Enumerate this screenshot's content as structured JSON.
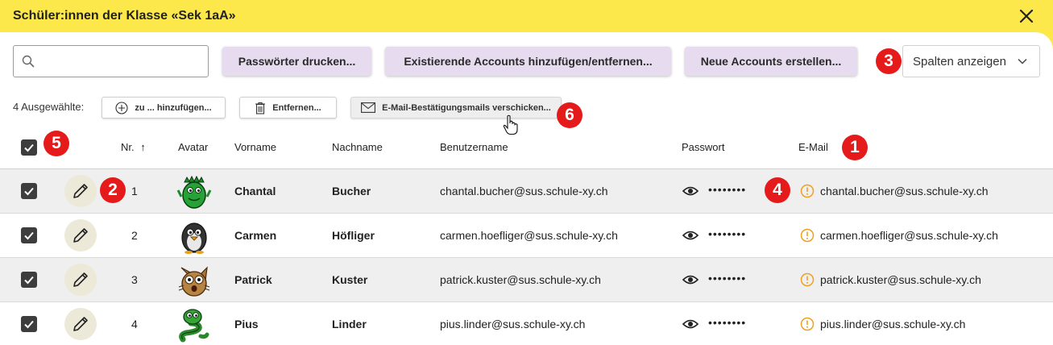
{
  "window": {
    "title": "Schüler:innen der Klasse «Sek 1aA»"
  },
  "toolbar": {
    "search_placeholder": "",
    "print_passwords": "Passwörter drucken...",
    "add_remove_accounts": "Existierende Accounts hinzufügen/entfernen...",
    "new_accounts": "Neue Accounts erstellen...",
    "columns_select": "Spalten anzeigen"
  },
  "selection": {
    "count_label": "4 Ausgewählte:",
    "add_to": "zu ... hinzufügen...",
    "remove": "Entfernen...",
    "send_mails": "E-Mail-Bestätigungsmails verschicken..."
  },
  "table": {
    "columns": [
      "Nr.",
      "Avatar",
      "Vorname",
      "Nachname",
      "Benutzername",
      "Passwort",
      "E-Mail"
    ],
    "sort_indicator": "↑",
    "rows": [
      {
        "nr": "1",
        "first": "Chantal",
        "last": "Bucher",
        "username": "chantal.bucher@sus.schule-xy.ch",
        "password": "••••••••",
        "email": "chantal.bucher@sus.schule-xy.ch",
        "avatar": "green-dragon"
      },
      {
        "nr": "2",
        "first": "Carmen",
        "last": "Höfliger",
        "username": "carmen.hoefliger@sus.schule-xy.ch",
        "password": "••••••••",
        "email": "carmen.hoefliger@sus.schule-xy.ch",
        "avatar": "penguin"
      },
      {
        "nr": "3",
        "first": "Patrick",
        "last": "Kuster",
        "username": "patrick.kuster@sus.schule-xy.ch",
        "password": "••••••••",
        "email": "patrick.kuster@sus.schule-xy.ch",
        "avatar": "owl-cat"
      },
      {
        "nr": "4",
        "first": "Pius",
        "last": "Linder",
        "username": "pius.linder@sus.schule-xy.ch",
        "password": "••••••••",
        "email": "pius.linder@sus.schule-xy.ch",
        "avatar": "green-snake"
      }
    ]
  },
  "badges": [
    "1",
    "2",
    "3",
    "4",
    "5",
    "6"
  ],
  "colors": {
    "header": "#fce84a",
    "primary_button": "#e7dcef",
    "badge": "#e51a1a",
    "warning": "#f0a020",
    "row_alt": "#efefef"
  }
}
